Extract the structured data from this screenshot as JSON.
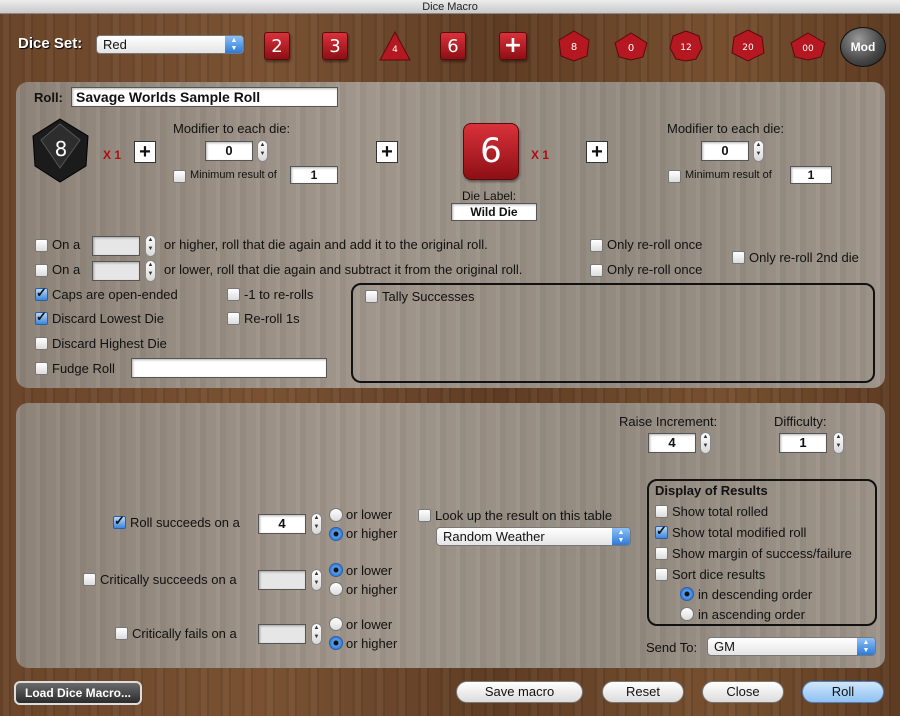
{
  "window": {
    "title": "Dice Macro"
  },
  "toolbar": {
    "dice_set_label": "Dice Set:",
    "dice_set_value": "Red",
    "dice": [
      "2",
      "3",
      "4",
      "6",
      "+",
      "8",
      "0",
      "12",
      "20",
      "00"
    ],
    "mod_label": "Mod"
  },
  "roll": {
    "label": "Roll:",
    "name": "Savage Worlds Sample Roll"
  },
  "die1": {
    "face": "8",
    "multiplier": "X 1",
    "modifier_label": "Modifier to each die:",
    "modifier": "0",
    "min_label": "Minimum result of",
    "min_value": "1"
  },
  "die2": {
    "face": "6",
    "multiplier": "X 1",
    "modifier_label": "Modifier to each die:",
    "modifier": "0",
    "min_label": "Minimum result of",
    "min_value": "1",
    "die_label_caption": "Die Label:",
    "die_label_value": "Wild Die"
  },
  "options": {
    "on_a_1": "On a",
    "higher_text": "or higher, roll that die again and add it to the original roll.",
    "on_a_2": "On a",
    "lower_text": "or lower, roll that die again and subtract it from the original roll.",
    "only_reroll_once_1": "Only re-roll once",
    "only_reroll_once_2": "Only re-roll once",
    "only_reroll_2nd": "Only re-roll 2nd die",
    "caps_open": "Caps are open-ended",
    "minus1": "-1 to re-rolls",
    "discard_lowest": "Discard Lowest Die",
    "reroll_1s": "Re-roll 1s",
    "discard_highest": "Discard Highest Die",
    "fudge": "Fudge Roll",
    "tally": "Tally Successes"
  },
  "results": {
    "raise_label": "Raise Increment:",
    "raise_value": "4",
    "difficulty_label": "Difficulty:",
    "difficulty_value": "1",
    "succeeds_label": "Roll succeeds on a",
    "succeeds_value": "4",
    "or_lower": "or lower",
    "or_higher": "or higher",
    "crit_succ_label": "Critically succeeds on a",
    "crit_fail_label": "Critically fails on a",
    "lookup_label": "Look up the result on this table",
    "lookup_table": "Random Weather",
    "display_title": "Display of Results",
    "show_total": "Show total rolled",
    "show_modified": "Show total modified roll",
    "show_margin": "Show margin of success/failure",
    "sort_dice": "Sort dice results",
    "desc": "in descending order",
    "asc": "in ascending order",
    "send_to_label": "Send To:",
    "send_to_value": "GM"
  },
  "buttons": {
    "load": "Load Dice Macro...",
    "save": "Save macro",
    "reset": "Reset",
    "close": "Close",
    "roll": "Roll"
  }
}
